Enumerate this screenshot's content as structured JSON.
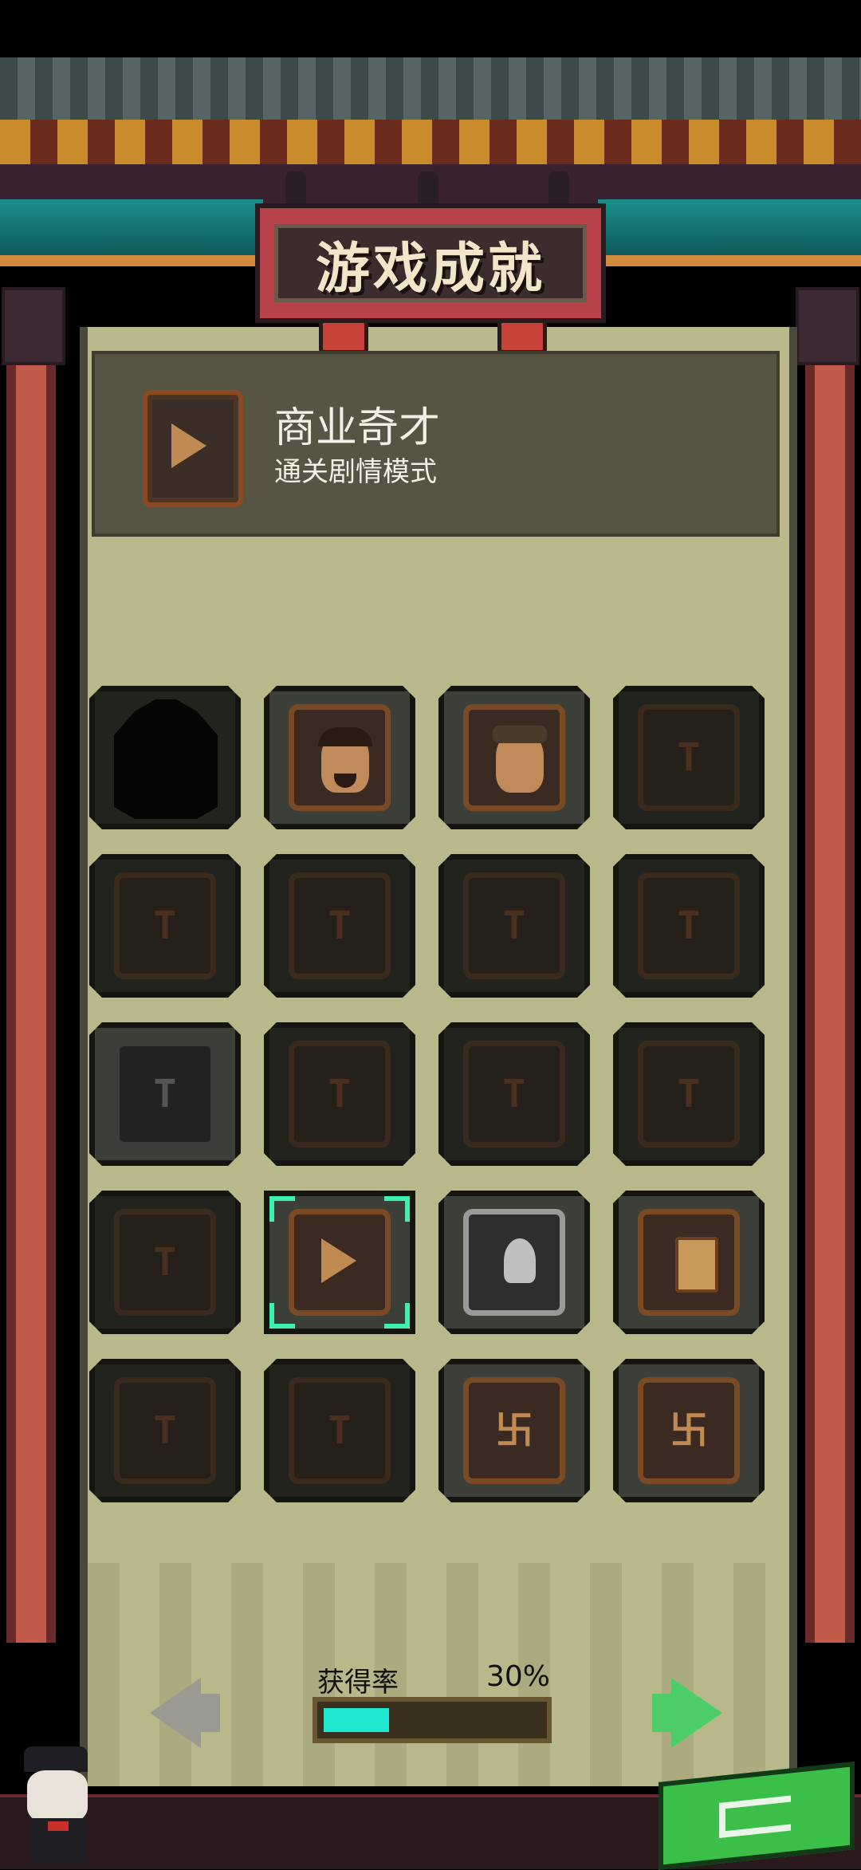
{
  "title": "游戏成就",
  "selected_achievement": {
    "name": "商业奇才",
    "description": "通关剧情模式",
    "icon": "play-badge-icon"
  },
  "achievements": [
    {
      "id": 1,
      "state": "locked-shadow",
      "icon": "silhouette-icon"
    },
    {
      "id": 2,
      "state": "unlocked",
      "icon": "bearded-man-portrait-icon"
    },
    {
      "id": 3,
      "state": "unlocked",
      "icon": "capped-man-portrait-icon"
    },
    {
      "id": 4,
      "state": "locked",
      "icon": "locked-badge-icon"
    },
    {
      "id": 5,
      "state": "locked",
      "icon": "locked-badge-icon"
    },
    {
      "id": 6,
      "state": "locked",
      "icon": "locked-badge-icon"
    },
    {
      "id": 7,
      "state": "locked",
      "icon": "locked-badge-icon"
    },
    {
      "id": 8,
      "state": "locked",
      "icon": "locked-badge-icon"
    },
    {
      "id": 9,
      "state": "locked-silver",
      "icon": "locked-silver-badge-icon"
    },
    {
      "id": 10,
      "state": "locked-laurel",
      "icon": "locked-laurel-badge-icon"
    },
    {
      "id": 11,
      "state": "locked-laurel",
      "icon": "locked-laurel-badge-icon"
    },
    {
      "id": 12,
      "state": "locked-laurel",
      "icon": "locked-laurel-badge-icon"
    },
    {
      "id": 13,
      "state": "locked-laurel",
      "icon": "locked-laurel-badge-icon"
    },
    {
      "id": 14,
      "state": "unlocked-selected",
      "icon": "play-badge-icon"
    },
    {
      "id": 15,
      "state": "unlocked-silver",
      "icon": "ghost-badge-icon"
    },
    {
      "id": 16,
      "state": "unlocked",
      "icon": "card-badge-icon"
    },
    {
      "id": 17,
      "state": "locked-laurel",
      "icon": "locked-laurel-badge-icon"
    },
    {
      "id": 18,
      "state": "locked",
      "icon": "locked-badge-icon"
    },
    {
      "id": 19,
      "state": "unlocked",
      "icon": "maze-badge-icon"
    },
    {
      "id": 20,
      "state": "unlocked",
      "icon": "maze-badge-icon"
    }
  ],
  "progress": {
    "label": "获得率",
    "value_text": "30%",
    "fraction": 0.3
  },
  "nav": {
    "prev_icon": "left-arrow-icon",
    "next_icon": "right-arrow-icon",
    "back_icon": "return-icon"
  },
  "colors": {
    "accent_fill": "#20e8d0",
    "next_arrow": "#4ccd6a",
    "back_button": "#3cbf48"
  }
}
